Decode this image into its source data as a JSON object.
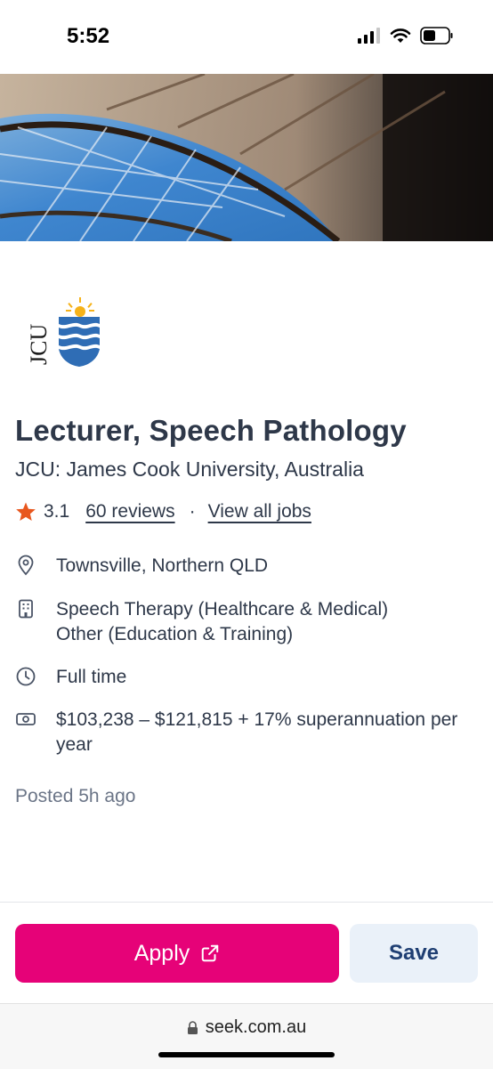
{
  "status_bar": {
    "time": "5:52"
  },
  "job": {
    "title": "Lecturer, Speech Pathology",
    "company": "JCU: James Cook University, Australia",
    "rating": "3.1",
    "reviews_link": "60 reviews",
    "separator": "·",
    "view_jobs_link": "View all jobs",
    "location": "Townsville, Northern QLD",
    "classification_line1": "Speech Therapy (Healthcare & Medical)",
    "classification_line2": "Other (Education & Training)",
    "work_type": "Full time",
    "salary": "$103,238 – $121,815 + 17% superannuation per year",
    "posted": "Posted 5h ago"
  },
  "logo_text": "JCU",
  "actions": {
    "apply_label": "Apply",
    "save_label": "Save"
  },
  "browser": {
    "url": "seek.com.au"
  },
  "colors": {
    "accent": "#e60278",
    "save_bg": "#eaf1f9",
    "save_text": "#1f3f73",
    "star": "#e8571e",
    "text": "#2e3849"
  },
  "icons": [
    "signal-icon",
    "wifi-icon",
    "battery-icon",
    "star-icon",
    "location-pin-icon",
    "building-icon",
    "clock-icon",
    "money-icon",
    "external-link-icon",
    "lock-icon"
  ]
}
